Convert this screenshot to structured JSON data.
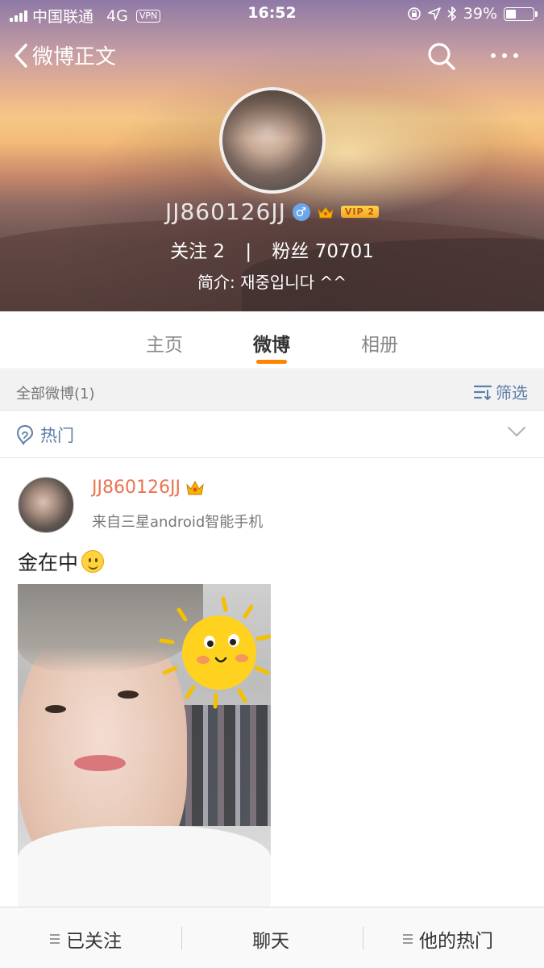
{
  "status_bar": {
    "carrier": "中国联通",
    "network": "4G",
    "vpn": "VPN",
    "time": "16:52",
    "battery": "39%",
    "battery_level": 0.39
  },
  "nav": {
    "back_label": "微博正文",
    "icons": [
      "chevron-left-icon",
      "search-icon",
      "more-icon"
    ]
  },
  "profile": {
    "username": "JJ860126JJ",
    "vip_label": "VIP 2",
    "follow_label": "关注",
    "follow_count": "2",
    "separator": "|",
    "fans_label": "粉丝",
    "fans_count": "70701",
    "bio": "简介: 재중입니다 ^^"
  },
  "tabs": [
    {
      "label": "主页"
    },
    {
      "label": "微博"
    },
    {
      "label": "相册"
    }
  ],
  "filter": {
    "count_label": "全部微博(1)",
    "filter_label": "筛选"
  },
  "hot": {
    "label": "热门"
  },
  "post": {
    "author": "JJ860126JJ",
    "source": "来自三星android智能手机",
    "text": "金在中"
  },
  "bottom_bar": {
    "followed": "已关注",
    "chat": "聊天",
    "his_hot": "他的热门"
  },
  "colors": {
    "accent_orange": "#ff8200",
    "link_blue": "#5e7ea8",
    "name_orange": "#eb7350"
  }
}
